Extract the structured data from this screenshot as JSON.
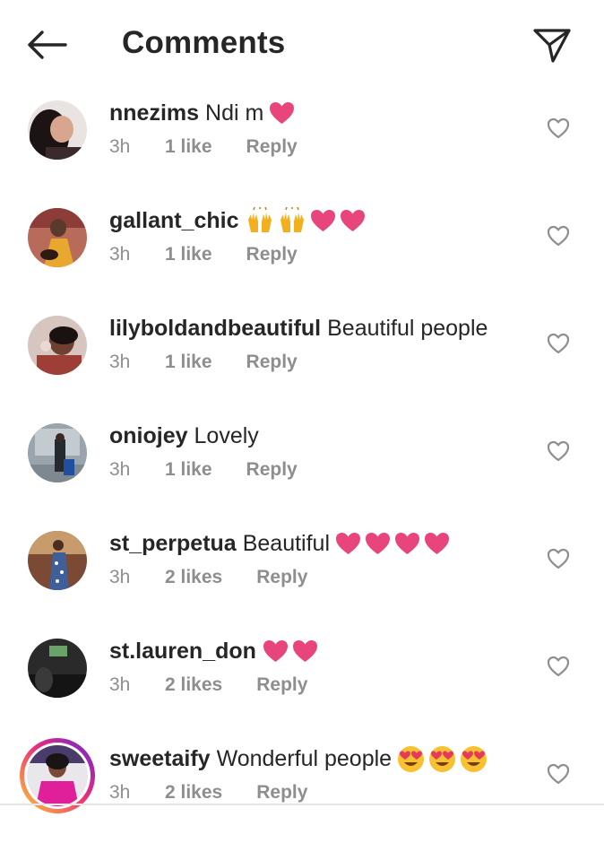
{
  "header": {
    "back_icon": "arrow-left-icon",
    "title": "Comments",
    "dm_icon": "paper-plane-icon"
  },
  "colors": {
    "text": "#262626",
    "meta": "#8e8e8e",
    "heart_emoji": "#e8457c",
    "raise_hands": "#f2b01e",
    "heart_eyes_face": "#f7c131"
  },
  "comments": [
    {
      "username": "nnezims",
      "text": "Ndi m",
      "emoji": [
        "pink-heart"
      ],
      "time": "3h",
      "likes": "1 like",
      "reply": "Reply",
      "avatar": "woman-curly-hair",
      "story_ring": false
    },
    {
      "username": "gallant_chic",
      "text": "",
      "emoji": [
        "raising-hands",
        "raising-hands",
        "pink-heart",
        "pink-heart"
      ],
      "time": "3h",
      "likes": "1 like",
      "reply": "Reply",
      "avatar": "woman-yellow-dress",
      "story_ring": false
    },
    {
      "username": "lilyboldandbeautiful",
      "text": "Beautiful people",
      "emoji": [],
      "time": "3h",
      "likes": "1 like",
      "reply": "Reply",
      "avatar": "woman-selfie",
      "story_ring": false
    },
    {
      "username": "oniojey",
      "text": "Lovely",
      "emoji": [],
      "time": "3h",
      "likes": "1 like",
      "reply": "Reply",
      "avatar": "man-with-suitcase",
      "story_ring": false
    },
    {
      "username": "st_perpetua",
      "text": "Beautiful",
      "emoji": [
        "pink-heart",
        "pink-heart",
        "pink-heart",
        "pink-heart"
      ],
      "time": "3h",
      "likes": "2 likes",
      "reply": "Reply",
      "avatar": "woman-patterned-dress",
      "story_ring": false
    },
    {
      "username": "st.lauren_don",
      "text": "",
      "emoji": [
        "pink-heart",
        "pink-heart"
      ],
      "time": "3h",
      "likes": "2 likes",
      "reply": "Reply",
      "avatar": "dark-room",
      "story_ring": false
    },
    {
      "username": "sweetaify",
      "text": "Wonderful people",
      "emoji": [
        "heart-eyes",
        "heart-eyes",
        "heart-eyes"
      ],
      "time": "3h",
      "likes": "2 likes",
      "reply": "Reply",
      "avatar": "woman-pink-outfit",
      "story_ring": true
    }
  ]
}
